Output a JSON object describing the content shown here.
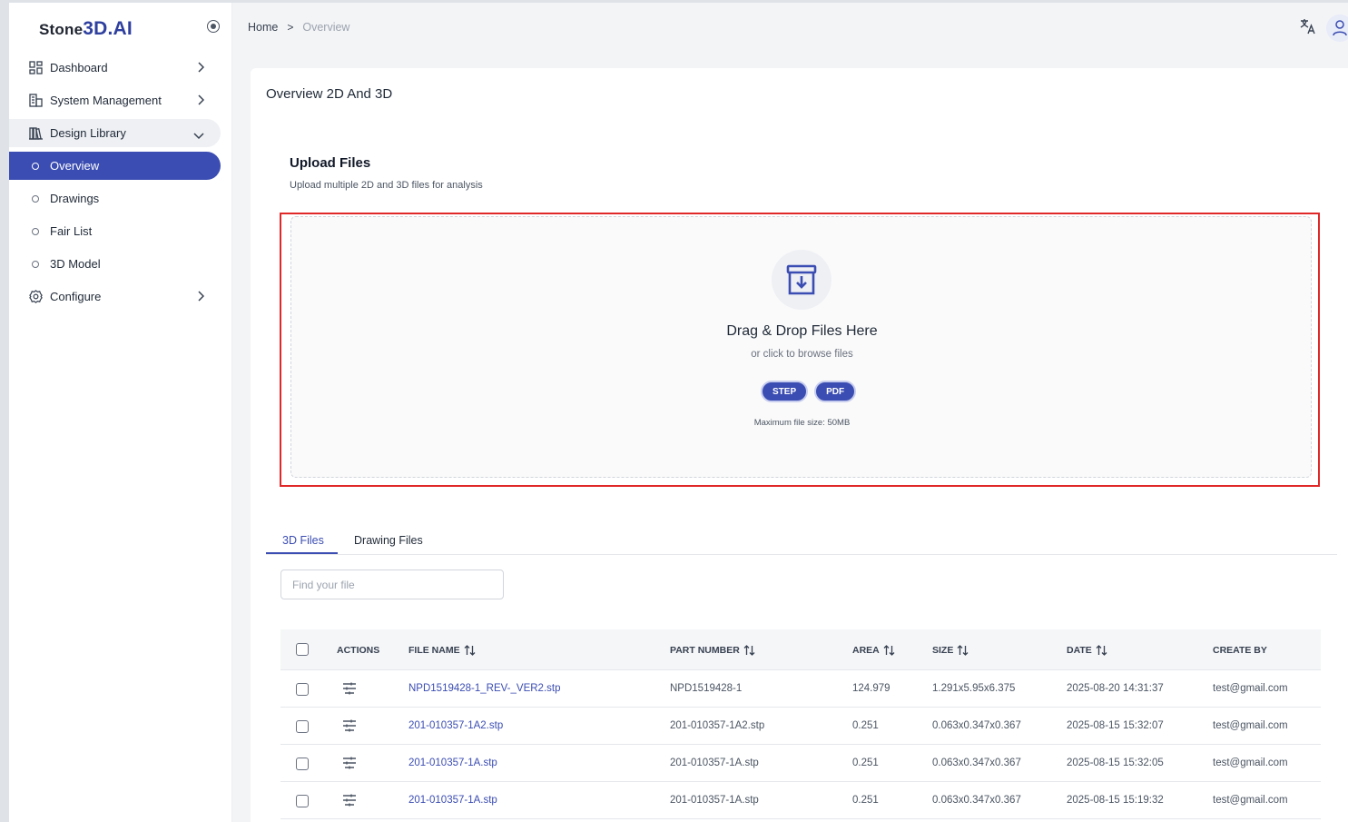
{
  "brand": {
    "part1": "Stone",
    "part2": "3D.AI"
  },
  "breadcrumb": {
    "home": "Home",
    "separator": ">",
    "current": "Overview"
  },
  "sidebar": {
    "items": [
      {
        "label": "Dashboard",
        "icon": "dashboard-icon"
      },
      {
        "label": "System Management",
        "icon": "building-icon"
      },
      {
        "label": "Design Library",
        "icon": "library-icon"
      },
      {
        "label": "Configure",
        "icon": "gear-icon"
      }
    ],
    "subitems": [
      {
        "label": "Overview",
        "active": true
      },
      {
        "label": "Drawings"
      },
      {
        "label": "Fair List"
      },
      {
        "label": "3D Model"
      }
    ]
  },
  "main": {
    "title": "Overview 2D And 3D",
    "upload": {
      "title": "Upload Files",
      "subtitle": "Upload multiple 2D and 3D files for analysis",
      "drop_title": "Drag & Drop Files Here",
      "drop_sub": "or click to browse files",
      "formats": [
        "STEP",
        "PDF"
      ],
      "max_size": "Maximum file size: 50MB"
    },
    "tabs": [
      "3D Files",
      "Drawing Files"
    ],
    "search": {
      "placeholder": "Find your file",
      "value": ""
    },
    "table": {
      "columns": [
        "ACTIONS",
        "FILE NAME",
        "PART NUMBER",
        "AREA",
        "SIZE",
        "DATE",
        "CREATE BY"
      ],
      "rows": [
        {
          "file": "NPD1519428-1_REV-_VER2.stp",
          "part": "NPD1519428-1",
          "area": "124.979",
          "size": "1.291x5.95x6.375",
          "date": "2025-08-20 14:31:37",
          "by": "test@gmail.com"
        },
        {
          "file": "201-010357-1A2.stp",
          "part": "201-010357-1A2.stp",
          "area": "0.251",
          "size": "0.063x0.347x0.367",
          "date": "2025-08-15 15:32:07",
          "by": "test@gmail.com"
        },
        {
          "file": "201-010357-1A.stp",
          "part": "201-010357-1A.stp",
          "area": "0.251",
          "size": "0.063x0.347x0.367",
          "date": "2025-08-15 15:32:05",
          "by": "test@gmail.com"
        },
        {
          "file": "201-010357-1A.stp",
          "part": "201-010357-1A.stp",
          "area": "0.251",
          "size": "0.063x0.347x0.367",
          "date": "2025-08-15 15:19:32",
          "by": "test@gmail.com"
        }
      ]
    }
  },
  "colors": {
    "accent": "#3b4db2",
    "highlight": "#e02828"
  }
}
